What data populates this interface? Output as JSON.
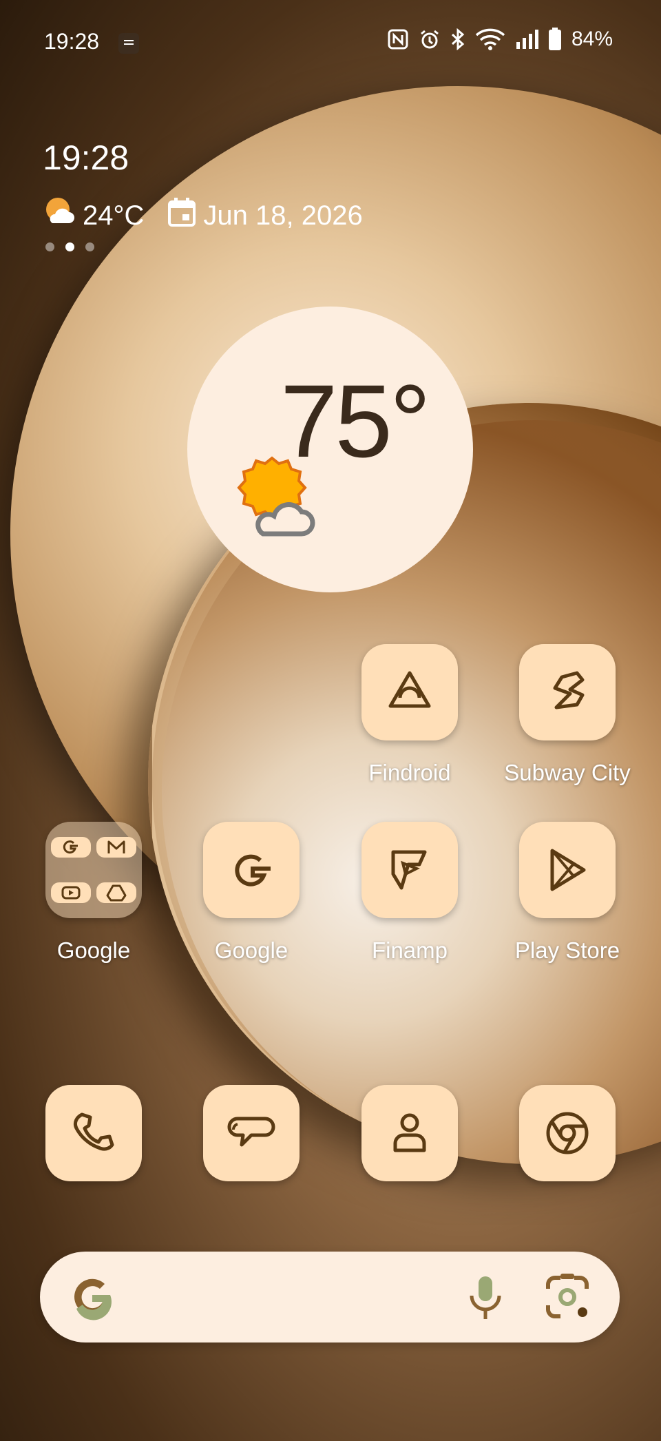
{
  "status_bar": {
    "time": "19:28",
    "battery": "84%",
    "icons": [
      "notification-icon",
      "nfc-icon",
      "alarm-icon",
      "bluetooth-icon",
      "wifi-icon",
      "signal-icon",
      "battery-icon"
    ]
  },
  "glance": {
    "time": "19:28",
    "temperature": "24°C",
    "date": "Jun 18, 2026",
    "weather_icon": "partly-cloudy-icon",
    "calendar_icon": "calendar-icon"
  },
  "page_indicator": {
    "pages": 3,
    "active_index": 1
  },
  "weather_widget": {
    "temperature": "75°",
    "icon": "sun-cloud-icon"
  },
  "apps": {
    "findroid": "Findroid",
    "subway_city": "Subway City",
    "google_folder": "Google",
    "google": "Google",
    "finamp": "Finamp",
    "play_store": "Play Store"
  },
  "dock": [
    "phone-icon",
    "messages-icon",
    "contacts-icon",
    "chrome-icon"
  ],
  "search_bar": {
    "icons": [
      "google-g-icon",
      "mic-icon",
      "lens-icon"
    ]
  },
  "colors": {
    "tile": "#ffdfb8",
    "icon_stroke": "#5a3a12",
    "widget_bg": "#fdeee0"
  }
}
